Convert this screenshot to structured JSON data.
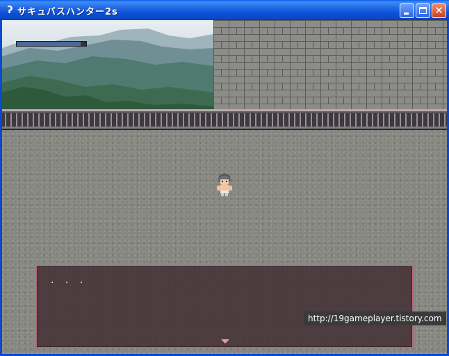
{
  "window": {
    "title": "サキュバスハンター2s",
    "icon": "app-icon",
    "controls": {
      "minimize": "minimize-icon",
      "maximize": "maximize-icon",
      "close": "close-icon",
      "close_glyph": "✕"
    }
  },
  "hud": {
    "hp_fraction": 0.92
  },
  "scene": {
    "background_left": "mountain-landscape",
    "background_right": "stone-brick-wall",
    "railing": "iron-railing",
    "floor": "stone-floor",
    "player": "player-character"
  },
  "message": {
    "text": ". . .",
    "next_indicator": "next-arrow-icon"
  },
  "watermark": {
    "text": "http://19gameplayer.tistory.com"
  },
  "colors": {
    "titlebar": "#0a5ee8",
    "message_border": "#b6697c",
    "message_bg": "#46323a",
    "next_arrow": "#e89aa8"
  }
}
